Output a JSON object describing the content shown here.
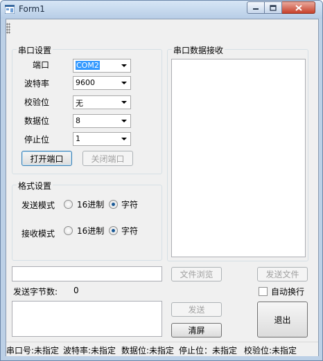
{
  "window": {
    "title": "Form1"
  },
  "serial_settings": {
    "group_label": "串口设置",
    "port_label": "端口",
    "port_value": "COM2",
    "baud_label": "波特率",
    "baud_value": "9600",
    "parity_label": "校验位",
    "parity_value": "无",
    "databits_label": "数据位",
    "databits_value": "8",
    "stopbits_label": "停止位",
    "stopbits_value": "1",
    "open_button": "打开端口",
    "close_button": "关闭端口"
  },
  "format_settings": {
    "group_label": "格式设置",
    "send_mode_label": "发送模式",
    "receive_mode_label": "接收模式",
    "hex_option": "16进制",
    "char_option": "字符",
    "send_mode_selected": "字符",
    "receive_mode_selected": "字符"
  },
  "receive": {
    "group_label": "串口数据接收",
    "text": ""
  },
  "send": {
    "file_path": "",
    "browse_button": "文件浏览",
    "send_file_button": "发送文件",
    "bytes_label": "发送字节数:",
    "bytes_value": "0",
    "auto_newline_label": "自动换行",
    "send_text": "",
    "send_button": "发送",
    "clear_button": "清屏",
    "exit_button": "退出"
  },
  "statusbar": {
    "port": "串口号:未指定",
    "baud": "波特率:未指定",
    "databits": "数据位:未指定",
    "stopbits": "停止位：未指定",
    "parity": "校验位:未指定"
  }
}
